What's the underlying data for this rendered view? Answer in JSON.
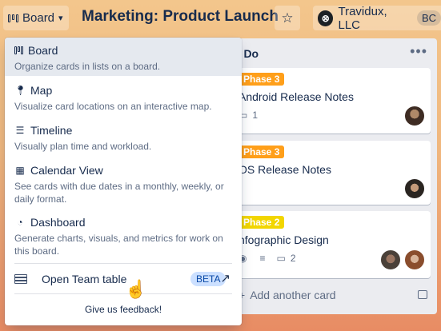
{
  "header": {
    "board_switch_label": "Board",
    "board_title": "Marketing: Product Launch",
    "team_name": "Travidux, LLC",
    "team_initials": "BC"
  },
  "dropdown": {
    "items": [
      {
        "label": "Board",
        "description": "Organize cards in lists on a board.",
        "icon": "board-icon"
      },
      {
        "label": "Map",
        "description": "Visualize card locations on an interactive map.",
        "icon": "map-pin-icon"
      },
      {
        "label": "Timeline",
        "description": "Visually plan time and workload.",
        "icon": "timeline-icon"
      },
      {
        "label": "Calendar View",
        "description": "See cards with due dates in a monthly, weekly, or daily format.",
        "icon": "calendar-icon"
      },
      {
        "label": "Dashboard",
        "description": "Generate charts, visuals, and metrics for work on this board.",
        "icon": "dashboard-icon"
      }
    ],
    "team_table": {
      "label": "Open Team table",
      "badge": "BETA"
    },
    "feedback": "Give us feedback!"
  },
  "list": {
    "title": "o Do",
    "add_card": "Add another card",
    "cards": [
      {
        "label": "Phase 3",
        "label_color": "#ff9f1a",
        "title": "Android Release Notes",
        "checklist_count": "1"
      },
      {
        "label": "Phase 3",
        "label_color": "#ff9f1a",
        "title": "OS Release Notes"
      },
      {
        "label": "Phase 2",
        "label_color": "#f2d600",
        "title": "nfographic Design",
        "attachment_count": "2"
      }
    ]
  }
}
